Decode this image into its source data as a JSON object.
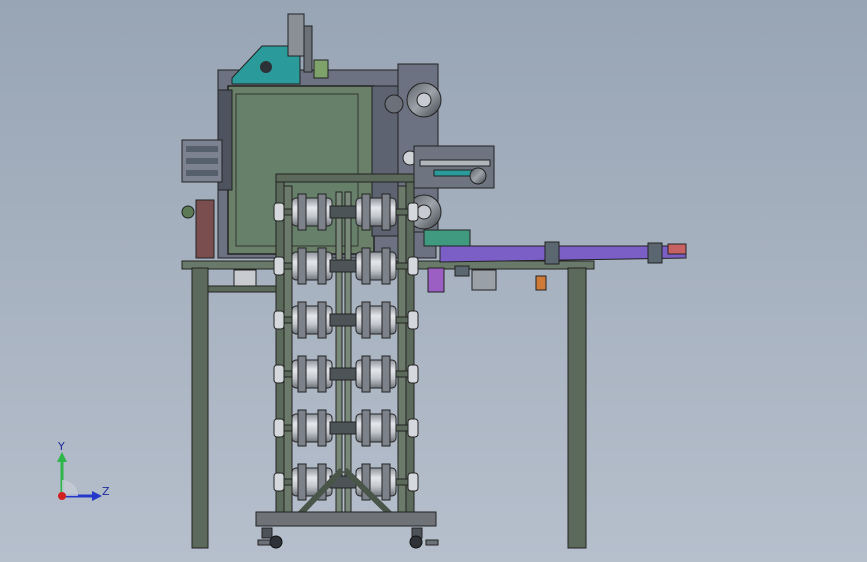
{
  "viewport": {
    "background_top": "#98a5b5",
    "background_bottom": "#b6bfcc"
  },
  "triad": {
    "y_label": "Y",
    "z_label": "Z",
    "y_color": "#2fb64a",
    "z_color": "#2538c9",
    "origin_color": "#d32020"
  },
  "model": {
    "frame_color": "#5b6a5b",
    "panel_color": "#6b8068",
    "machine_color": "#6d7283",
    "accent_color": "#2a9a9a",
    "conveyor_color": "#7b5ec6",
    "roller_color": "#c9cdd3",
    "roller_stages": 6
  }
}
